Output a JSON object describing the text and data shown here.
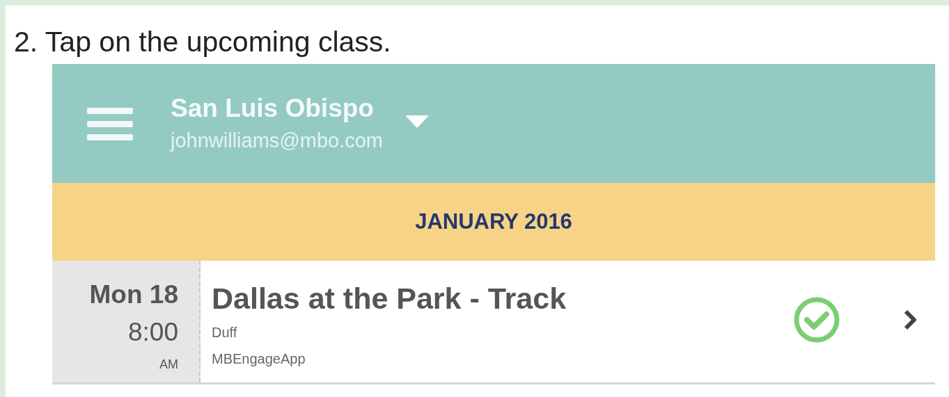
{
  "instruction": "2. Tap on the upcoming class.",
  "app_header": {
    "location": "San Luis Obispo",
    "email": "johnwilliams@mbo.com"
  },
  "month_header": "JANUARY 2016",
  "classes": [
    {
      "day": "Mon 18",
      "time": "8:00",
      "meridiem": "AM",
      "name": "Dallas at the Park - Track",
      "instructor": "Duff",
      "source": "MBEngageApp",
      "checked": true
    }
  ]
}
